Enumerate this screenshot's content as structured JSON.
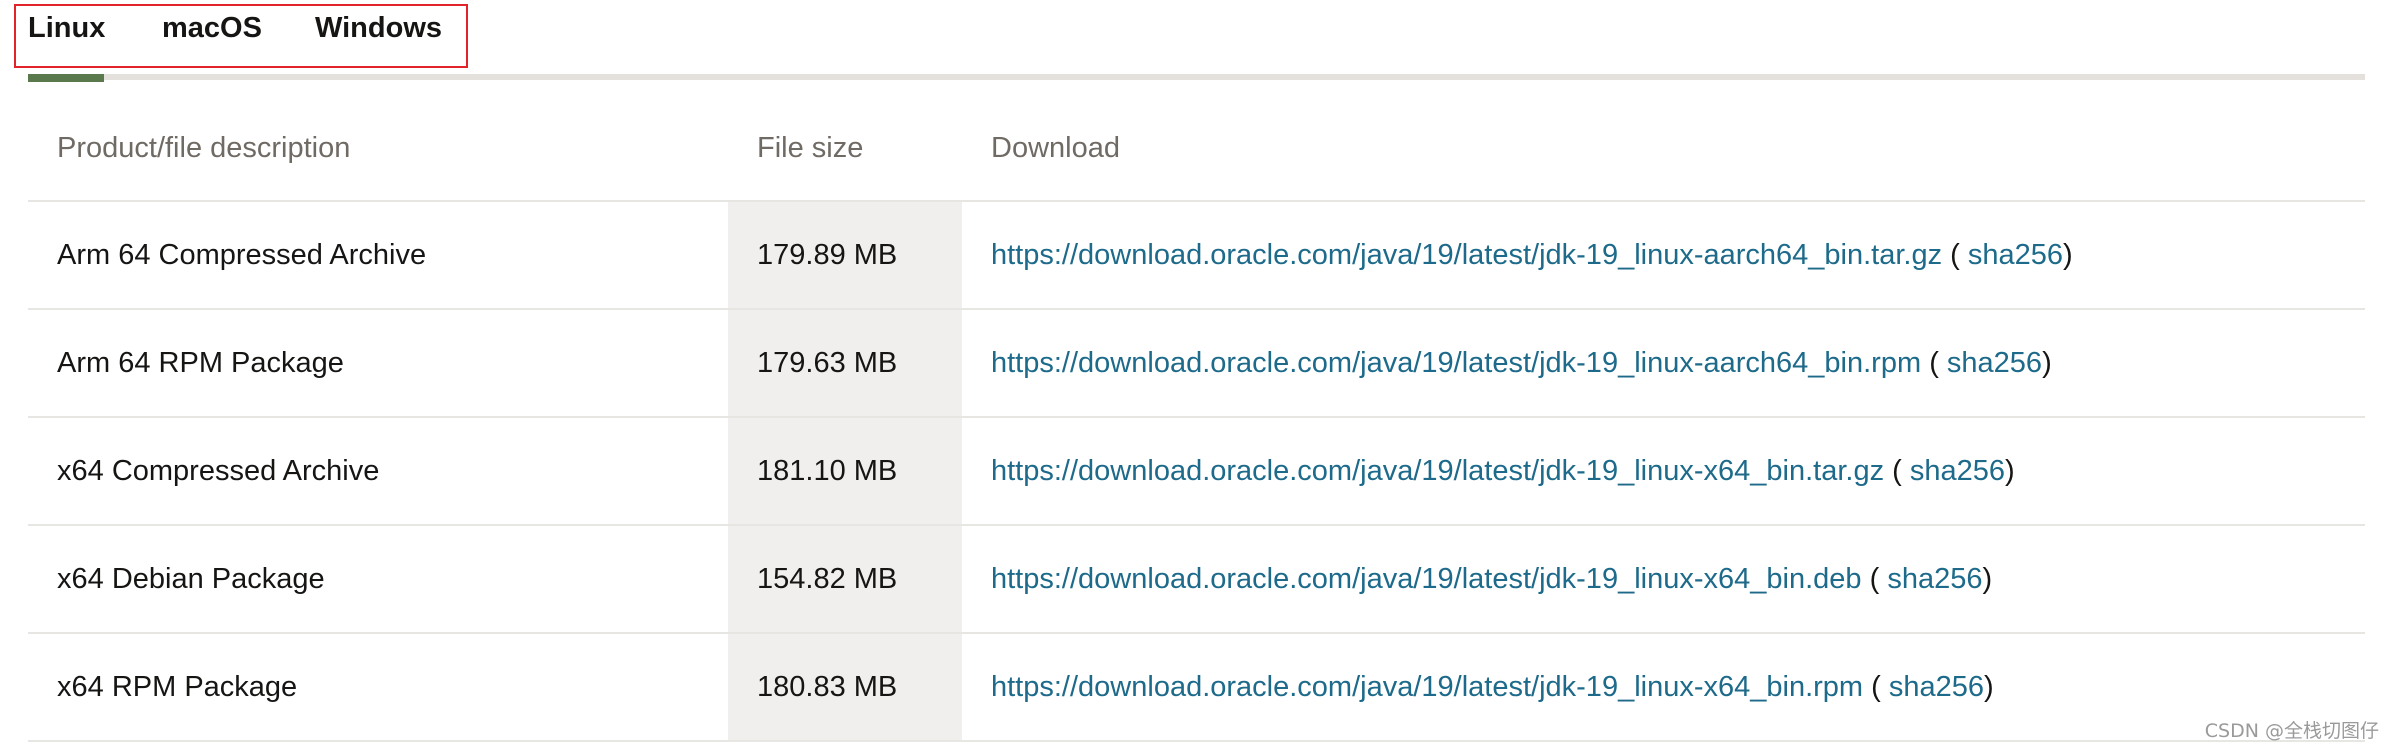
{
  "tabs": {
    "items": [
      {
        "label": "Linux",
        "active": true
      },
      {
        "label": "macOS",
        "active": false
      },
      {
        "label": "Windows",
        "active": false
      }
    ],
    "active_indicator_color": "#5a7a4e",
    "highlight_box_color": "#e0242a"
  },
  "table": {
    "headers": {
      "description": "Product/file description",
      "size": "File size",
      "download": "Download"
    },
    "rows": [
      {
        "description": "Arm 64 Compressed Archive",
        "size": "179.89 MB",
        "url": "https://download.oracle.com/java/19/latest/jdk-19_linux-aarch64_bin.tar.gz",
        "checksum_label": "sha256"
      },
      {
        "description": "Arm 64 RPM Package",
        "size": "179.63 MB",
        "url": "https://download.oracle.com/java/19/latest/jdk-19_linux-aarch64_bin.rpm",
        "checksum_label": "sha256"
      },
      {
        "description": "x64 Compressed Archive",
        "size": "181.10 MB",
        "url": "https://download.oracle.com/java/19/latest/jdk-19_linux-x64_bin.tar.gz",
        "checksum_label": "sha256"
      },
      {
        "description": "x64 Debian Package",
        "size": "154.82 MB",
        "url": "https://download.oracle.com/java/19/latest/jdk-19_linux-x64_bin.deb",
        "checksum_label": "sha256"
      },
      {
        "description": "x64 RPM Package",
        "size": "180.83 MB",
        "url": "https://download.oracle.com/java/19/latest/jdk-19_linux-x64_bin.rpm",
        "checksum_label": "sha256"
      }
    ],
    "link_color": "#1d6a8a"
  },
  "watermark": "CSDN @全栈切图仔"
}
